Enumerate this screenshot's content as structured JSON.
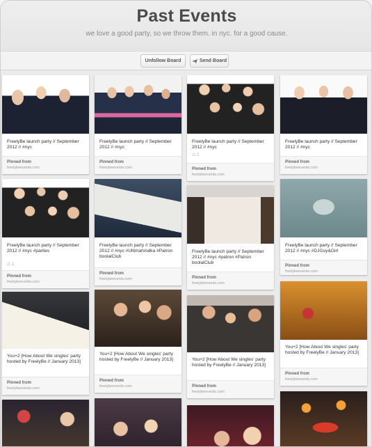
{
  "header": {
    "title": "Past Events",
    "subtitle": "we love a good party, so we throw them. in nyc. for a good cause."
  },
  "toolbar": {
    "unfollow_label": "Unfollow Board",
    "send_label": "Send Board"
  },
  "pins": [
    {
      "desc": "FreelyBe launch party // September 2012 // #nyc",
      "stat": "",
      "pinned_from": "Pinned from",
      "source": "freelybeevents.com",
      "photo": "group-photo"
    },
    {
      "desc": "FreelyBe launch party // September 2012 // #nyc",
      "stat": "",
      "pinned_from": "Pinned from",
      "source": "freelybeevents.com",
      "photo": "group-photo"
    },
    {
      "desc": "FreelyBe launch party // September 2012 // #nyc",
      "stat": "♺ 1",
      "pinned_from": "Pinned from",
      "source": "freelybeevents.com",
      "photo": "group-photo"
    },
    {
      "desc": "FreelyBe launch party // September 2012 // #nyc",
      "stat": "",
      "pinned_from": "Pinned from",
      "source": "freelybeevents.com",
      "photo": "group-photo"
    },
    {
      "desc": "FreelyBe launch party // September 2012 // #nyc #parties",
      "stat": "♺ 1",
      "pinned_from": "Pinned from",
      "source": "freelybeevents.com",
      "photo": "crowd-photo"
    },
    {
      "desc": "FreelyBe launch party // September 2012 // #nyc #UltimatVodka #Patron boolalClub",
      "stat": "",
      "pinned_from": "Pinned from",
      "source": "freelybeevents.com",
      "photo": "vodka-bag-photo"
    },
    {
      "desc": "FreelyBe launch party // September 2012 // #nyc #patron #Patron boolalClub",
      "stat": "",
      "pinned_from": "Pinned from",
      "source": "freelybeevents.com",
      "photo": "taste-sign-photo"
    },
    {
      "desc": "FreelyBe launch party // September 2012 // #nyc #DJGuy&Girl",
      "stat": "",
      "pinned_from": "Pinned from",
      "source": "freelybeevents.com",
      "photo": "guy-and-girl-photo"
    },
    {
      "desc": "You+2 [How About We singles' party hosted by FreelyBe // January 2013]",
      "stat": "",
      "pinned_from": "Pinned from",
      "source": "freelybeevents.com",
      "photo": "for-sale-sign-photo"
    },
    {
      "desc": "You+2 [How About We singles' party hosted by FreelyBe // January 2013]",
      "stat": "",
      "pinned_from": "Pinned from",
      "source": "freelybeevents.com",
      "photo": "party-guests-photo"
    },
    {
      "desc": "You+2 [How About We singles' party hosted by FreelyBe // January 2013]",
      "stat": "",
      "pinned_from": "Pinned from",
      "source": "freelybeevents.com",
      "photo": "dancing-photo"
    },
    {
      "desc": "You+2 [How About We singles' party hosted by FreelyBe // January 2013]",
      "stat": "",
      "pinned_from": "Pinned from",
      "source": "freelybeevents.com",
      "photo": "heart-sign-photo"
    },
    {
      "photo": "costume-photo"
    },
    {
      "photo": "party-hats-photo"
    },
    {
      "photo": "selfie-photo"
    },
    {
      "photo": "birthday-hat-photo"
    }
  ]
}
